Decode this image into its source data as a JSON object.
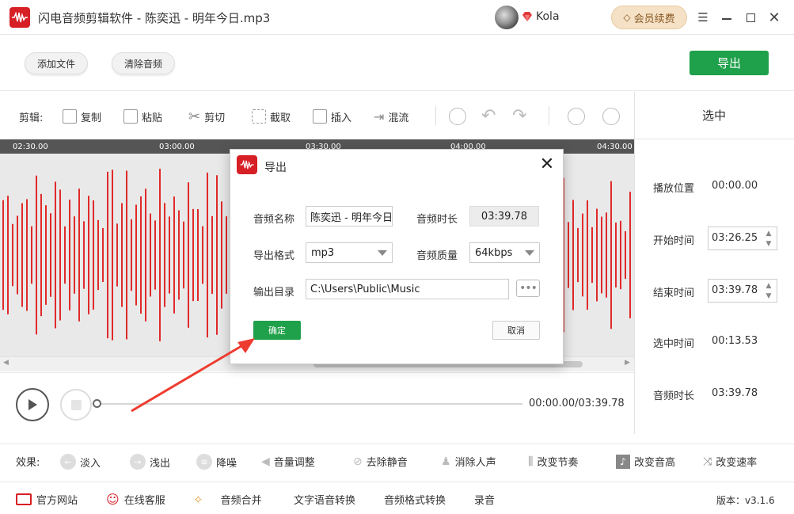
{
  "app": {
    "title": "闪电音频剪辑软件 - 陈奕迅 - 明年今日.mp3",
    "username": "Kola",
    "renew_label": "会员续费",
    "version": "版本：v3.1.6"
  },
  "toolbar": {
    "add_file": "添加文件",
    "clear_audio": "清除音频",
    "export": "导出"
  },
  "edit": {
    "label": "剪辑:",
    "copy": "复制",
    "paste": "粘贴",
    "cut": "剪切",
    "crop": "截取",
    "insert": "插入",
    "mix": "混流"
  },
  "timeline": {
    "ticks": [
      "02:30.00",
      "03:00.00",
      "03:30.00",
      "04:00.00",
      "04:30.00"
    ]
  },
  "player": {
    "time": "00:00.00/03:39.78"
  },
  "right_panel": {
    "header": "选中",
    "play_pos_label": "播放位置",
    "play_pos_value": "00:00.00",
    "start_label": "开始时间",
    "start_value": "03:26.25",
    "end_label": "结束时间",
    "end_value": "03:39.78",
    "sel_label": "选中时间",
    "sel_value": "00:13.53",
    "dur_label": "音频时长",
    "dur_value": "03:39.78"
  },
  "effects": {
    "label": "效果:",
    "items": [
      "淡入",
      "浅出",
      "降噪",
      "音量调整",
      "去除静音",
      "消除人声",
      "改变节奏",
      "改变音高",
      "改变速率"
    ]
  },
  "bottom": {
    "items": [
      "官方网站",
      "在线客服",
      "音频合并",
      "文字语音转换",
      "音频格式转换",
      "录音"
    ]
  },
  "dialog": {
    "title": "导出",
    "name_label": "音频名称",
    "name_value": "陈奕迅 - 明年今日",
    "duration_label": "音频时长",
    "duration_value": "03:39.78",
    "format_label": "导出格式",
    "format_value": "mp3",
    "quality_label": "音频质量",
    "quality_value": "64kbps",
    "dir_label": "输出目录",
    "dir_value": "C:\\Users\\Public\\Music",
    "browse": "•••",
    "confirm": "确定",
    "cancel": "取消"
  },
  "colors": {
    "brand_red": "#d71f26",
    "export_green": "#1fa04a",
    "wave_red": "#e02a2a",
    "annotation_arrow": "#ee3b30"
  }
}
